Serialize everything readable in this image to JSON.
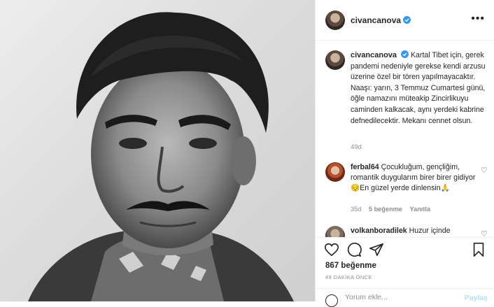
{
  "post": {
    "username": "civancanova",
    "more_label": "•••"
  },
  "caption": {
    "username": "civancanova",
    "text": "Kartal Tibet için, gerek pandemi nedeniyle gerekse kendi arzusu üzerine özel bir tören yapılmayacaktır. Naaşı: yarın, 3 Temmuz Cumartesi günü, öğle namazını müteakip Zincirlikuyu caminden kalkacak, aynı yerdeki kabrine defnedilecektir. Mekanı cennet olsun.",
    "time": "49d"
  },
  "comments": [
    {
      "username": "ferbal64",
      "text": "Çocukluğum, gençliğim, romantik duygularım birer birer gidiyor😔En güzel yerde dinlensin🙏",
      "time": "35d",
      "likes": "5 beğenme",
      "reply": "Yanıtla"
    },
    {
      "username": "volkanboradilek",
      "text": "Huzur içinde"
    }
  ],
  "actions": {
    "likes": "867 beğenme",
    "time_ago": "49 DAKİKA ÖNCE",
    "comment_placeholder": "Yorum ekle...",
    "post_label": "Paylaş"
  },
  "icons": [
    "more-icon",
    "verified-icon",
    "heart-icon",
    "comment-icon",
    "share-icon",
    "save-icon",
    "emoji-icon"
  ],
  "colors": {
    "verified": "#3897f0",
    "muted": "#8e8e8e",
    "post_button": "#b2dffc"
  }
}
